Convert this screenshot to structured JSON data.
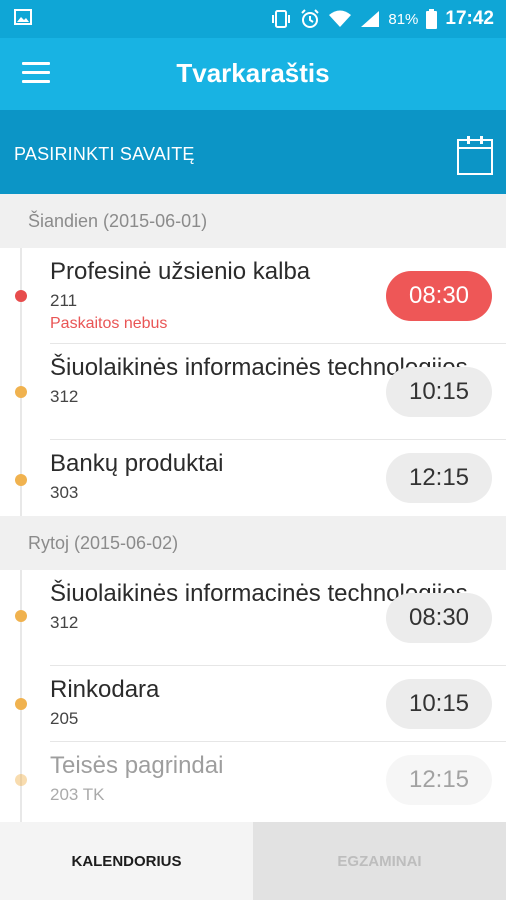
{
  "status_bar": {
    "battery": "81%",
    "time": "17:42",
    "icons": [
      "image-icon",
      "vibrate-icon",
      "alarm-icon",
      "wifi-icon",
      "signal-icon",
      "battery-icon"
    ]
  },
  "app_bar": {
    "title": "Tvarkaraštis",
    "menu_icon": "hamburger-menu-icon"
  },
  "week_selector": {
    "label": "PASIRINKTI SAVAITĘ",
    "icon": "calendar-icon"
  },
  "days": [
    {
      "header": "Šiandien (2015-06-01)",
      "lessons": [
        {
          "subject": "Profesinė  užsienio kalba",
          "room": "211",
          "note": "Paskaitos nebus",
          "time": "08:30",
          "status": "cancelled"
        },
        {
          "subject": "Šiuolaikinės informacinės technologijos",
          "room": "312",
          "note": "",
          "time": "10:15",
          "status": "normal"
        },
        {
          "subject": "Bankų produktai",
          "room": "303",
          "note": "",
          "time": "12:15",
          "status": "normal"
        }
      ]
    },
    {
      "header": "Rytoj (2015-06-02)",
      "lessons": [
        {
          "subject": "Šiuolaikinės informacinės technologijos",
          "room": "312",
          "note": "",
          "time": "08:30",
          "status": "normal"
        },
        {
          "subject": "Rinkodara",
          "room": "205",
          "note": "",
          "time": "10:15",
          "status": "normal"
        },
        {
          "subject": "Teisės pagrindai",
          "room": "203 TK",
          "note": "",
          "time": "12:15",
          "status": "normal"
        }
      ]
    }
  ],
  "tabs": [
    {
      "label": "KALENDORIUS",
      "active": true
    },
    {
      "label": "EGZAMINAI",
      "active": false
    }
  ],
  "colors": {
    "status_bar": "#0fa6d6",
    "app_bar": "#18b3e3",
    "week_bar": "#0c95c6",
    "cancelled": "#ee5757",
    "dot_cancelled": "#e74c4c",
    "dot_normal": "#f0b24f"
  }
}
